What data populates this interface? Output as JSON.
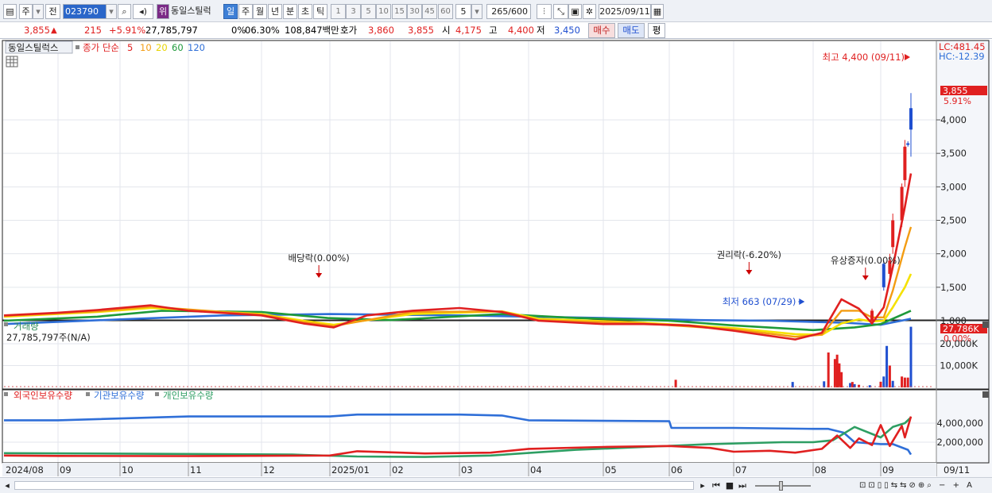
{
  "toolbar": {
    "type_label": "주",
    "prev_label": "전",
    "stock_code": "023790",
    "badge_label": "위",
    "stock_name": "동일스틸럭",
    "periods": [
      "일",
      "주",
      "월",
      "년",
      "분",
      "초",
      "틱"
    ],
    "active_period": "일",
    "intervals": [
      "1",
      "3",
      "5",
      "10",
      "15",
      "30",
      "45",
      "60"
    ],
    "interval_value": "5",
    "count_value": "265",
    "count_total": "/600",
    "date_value": "2025/09/11"
  },
  "quote": {
    "price": "3,855",
    "arrow": "▲",
    "change": "215",
    "change_pct": "+5.91%",
    "volume": "27,785,797",
    "turnover_pct": "0%",
    "rate": "06.30%",
    "amount": "108,847백만",
    "hoga_label": "호가",
    "ask": "3,860",
    "bid": "3,855",
    "open_label": "시",
    "open": "4,175",
    "high_label": "고",
    "high": "4,400",
    "low_label": "저",
    "low": "3,450",
    "buy_label": "매수",
    "sell_label": "매도",
    "avg_label": "평"
  },
  "colors": {
    "up": "#e02020",
    "down": "#1f4fd0",
    "ma5": "#e02020",
    "ma10": "#f39c12",
    "ma20": "#f5e100",
    "ma60": "#1e9a3a",
    "ma120": "#2f6fd8",
    "foreign": "#e02020",
    "institution": "#2f6fd8",
    "individual": "#2e9e63",
    "accent": "#3d7fd6"
  },
  "chart_data": [
    {
      "type": "line",
      "panel": "price",
      "title": "동일스틸럭스",
      "indicator_label": "종가 단순",
      "ma_periods": [
        "5",
        "10",
        "20",
        "60",
        "120"
      ],
      "lc_label": "LC:481.45",
      "hc_label": "HC:-12.39",
      "current_price_tag": "3,855",
      "current_pct_tag": "5.91%",
      "y_ticks": [
        1000,
        1500,
        2000,
        2500,
        3000,
        3500,
        4000
      ],
      "y_tick_labels": [
        "1,000",
        "1,500",
        "2,000",
        "2,500",
        "3,000",
        "3,500",
        "4,000"
      ],
      "ylim": [
        620,
        4600
      ],
      "x_tick_labels": [
        "2024/08",
        "09",
        "10",
        "11",
        "12",
        "2025/01",
        "02",
        "03",
        "04",
        "05",
        "06",
        "07",
        "08",
        "09",
        "09/11"
      ],
      "annotations": [
        {
          "text": "최고 4,400 (09/11)",
          "date": "2025-09-11",
          "value": 4400
        },
        {
          "text": "최저 663 (07/29)",
          "date": "2025-07-29",
          "value": 663
        },
        {
          "text": "배당락(0.00%)",
          "date": "2024-12-27"
        },
        {
          "text": "권리락(-6.20%)",
          "date": "2025-07-07"
        },
        {
          "text": "유상증자(0.00%)",
          "date": "2025-08-25"
        }
      ],
      "series": [
        {
          "name": "5",
          "x": [
            "2024-08-01",
            "2024-09-01",
            "2024-09-20",
            "2024-10-15",
            "2024-11-01",
            "2024-12-01",
            "2024-12-20",
            "2025-01-03",
            "2025-01-20",
            "2025-02-10",
            "2025-03-01",
            "2025-03-20",
            "2025-04-05",
            "2025-05-01",
            "2025-05-20",
            "2025-06-10",
            "2025-07-01",
            "2025-07-25",
            "2025-08-05",
            "2025-08-14",
            "2025-08-22",
            "2025-08-28",
            "2025-09-02",
            "2025-09-05",
            "2025-09-09",
            "2025-09-11"
          ],
          "values": [
            1080,
            1120,
            1160,
            1230,
            1150,
            1080,
            960,
            900,
            1080,
            1150,
            1190,
            1130,
            1000,
            950,
            950,
            930,
            850,
            720,
            820,
            1320,
            1180,
            960,
            1200,
            1800,
            2700,
            3200
          ]
        },
        {
          "name": "10",
          "x": [
            "2024-08-01",
            "2024-09-20",
            "2024-10-15",
            "2024-12-01",
            "2024-12-20",
            "2025-01-03",
            "2025-02-10",
            "2025-03-20",
            "2025-04-05",
            "2025-05-20",
            "2025-07-01",
            "2025-07-25",
            "2025-08-05",
            "2025-08-14",
            "2025-08-22",
            "2025-08-28",
            "2025-09-02",
            "2025-09-05",
            "2025-09-09",
            "2025-09-11"
          ],
          "values": [
            1070,
            1140,
            1210,
            1090,
            980,
            920,
            1130,
            1140,
            1010,
            960,
            870,
            760,
            790,
            1150,
            1150,
            1050,
            1050,
            1450,
            2100,
            2400
          ]
        },
        {
          "name": "20",
          "x": [
            "2024-08-01",
            "2024-09-20",
            "2024-10-15",
            "2024-12-01",
            "2024-12-20",
            "2025-01-03",
            "2025-02-10",
            "2025-03-20",
            "2025-04-05",
            "2025-05-20",
            "2025-07-01",
            "2025-07-25",
            "2025-08-05",
            "2025-08-14",
            "2025-08-22",
            "2025-08-28",
            "2025-09-02",
            "2025-09-05",
            "2025-09-09",
            "2025-09-11"
          ],
          "values": [
            1060,
            1130,
            1190,
            1100,
            1000,
            940,
            1100,
            1140,
            1030,
            970,
            890,
            800,
            790,
            960,
            1020,
            990,
            1000,
            1200,
            1500,
            1700
          ]
        },
        {
          "name": "60",
          "x": [
            "2024-08-01",
            "2024-09-20",
            "2024-10-20",
            "2024-12-01",
            "2024-12-31",
            "2025-02-01",
            "2025-03-20",
            "2025-04-20",
            "2025-06-01",
            "2025-07-01",
            "2025-08-01",
            "2025-08-20",
            "2025-09-01",
            "2025-09-11"
          ],
          "values": [
            1000,
            1060,
            1150,
            1130,
            1040,
            1010,
            1100,
            1040,
            1000,
            930,
            860,
            900,
            950,
            1150
          ]
        },
        {
          "name": "120",
          "x": [
            "2024-08-01",
            "2024-10-01",
            "2024-11-15",
            "2025-01-01",
            "2025-03-01",
            "2025-05-01",
            "2025-06-15",
            "2025-07-15",
            "2025-08-15",
            "2025-09-01",
            "2025-09-11"
          ],
          "values": [
            950,
            1020,
            1080,
            1100,
            1080,
            1040,
            1010,
            1000,
            970,
            940,
            1030
          ]
        }
      ]
    },
    {
      "type": "bar",
      "panel": "volume",
      "title": "거래량",
      "volume_readout": "27,785,797주(N/A)",
      "current_tag": "27,786K",
      "current_pct_tag": "0.00%",
      "y_ticks": [
        10000,
        20000
      ],
      "y_tick_labels": [
        "10,000K",
        "20,000K"
      ],
      "ylim": [
        0,
        28000
      ],
      "x": [
        "2025-06-04",
        "2025-07-24",
        "2025-08-06",
        "2025-08-08",
        "2025-08-11",
        "2025-08-12",
        "2025-08-13",
        "2025-08-14",
        "2025-08-18",
        "2025-08-19",
        "2025-08-20",
        "2025-08-22",
        "2025-08-27",
        "2025-09-01",
        "2025-09-02",
        "2025-09-03",
        "2025-09-04",
        "2025-09-05",
        "2025-09-08",
        "2025-09-09",
        "2025-09-10",
        "2025-09-11"
      ],
      "values": [
        3500,
        2500,
        2800,
        16000,
        13000,
        15000,
        11000,
        7000,
        2000,
        2500,
        1500,
        1200,
        1000,
        2600,
        5000,
        19000,
        10000,
        3000,
        5000,
        4500,
        4500,
        27786
      ],
      "colors": [
        "up",
        "down",
        "down",
        "up",
        "up",
        "up",
        "up",
        "up",
        "down",
        "up",
        "down",
        "up",
        "down",
        "up",
        "down",
        "down",
        "up",
        "down",
        "up",
        "up",
        "up",
        "down"
      ]
    },
    {
      "type": "line",
      "panel": "holdings",
      "series_labels": [
        "외국인보유수량",
        "기관보유수량",
        "개인보유수량"
      ],
      "y_ticks": [
        2000000,
        4000000
      ],
      "y_tick_labels": [
        "2,000,000",
        "4,000,000"
      ],
      "ylim": [
        0,
        5200000
      ],
      "series": [
        {
          "name": "외국인보유수량",
          "x": [
            "2024-08-01",
            "2024-09-01",
            "2024-11-01",
            "2025-01-01",
            "2025-01-15",
            "2025-02-15",
            "2025-03-15",
            "2025-04-01",
            "2025-05-01",
            "2025-06-01",
            "2025-06-20",
            "2025-07-01",
            "2025-07-15",
            "2025-07-25",
            "2025-08-05",
            "2025-08-12",
            "2025-08-18",
            "2025-08-22",
            "2025-08-28",
            "2025-09-01",
            "2025-09-04",
            "2025-09-08",
            "2025-09-09",
            "2025-09-11"
          ],
          "values": [
            600000,
            560000,
            540000,
            600000,
            1050000,
            820000,
            900000,
            1300000,
            1500000,
            1600000,
            1400000,
            1000000,
            1100000,
            900000,
            1300000,
            2700000,
            1400000,
            2400000,
            1700000,
            3800000,
            1600000,
            3700000,
            2500000,
            4700000
          ]
        },
        {
          "name": "기관보유수량",
          "x": [
            "2024-08-01",
            "2024-09-01",
            "2024-11-01",
            "2025-01-01",
            "2025-01-15",
            "2025-03-01",
            "2025-03-20",
            "2025-04-01",
            "2025-06-01",
            "2025-06-02",
            "2025-07-01",
            "2025-08-01",
            "2025-08-08",
            "2025-08-15",
            "2025-08-20",
            "2025-09-01",
            "2025-09-05",
            "2025-09-10",
            "2025-09-11"
          ],
          "values": [
            4300000,
            4300000,
            4700000,
            4700000,
            4900000,
            4900000,
            4800000,
            4300000,
            4200000,
            3500000,
            3500000,
            3400000,
            3400000,
            3000000,
            2000000,
            1800000,
            1800000,
            1200000,
            700000
          ]
        },
        {
          "name": "개인보유수량",
          "x": [
            "2024-08-01",
            "2024-10-01",
            "2024-12-15",
            "2025-01-15",
            "2025-02-15",
            "2025-03-15",
            "2025-04-20",
            "2025-05-20",
            "2025-06-20",
            "2025-07-20",
            "2025-08-01",
            "2025-08-10",
            "2025-08-20",
            "2025-09-01",
            "2025-09-05",
            "2025-09-09",
            "2025-09-11"
          ],
          "values": [
            850000,
            800000,
            700000,
            500000,
            450000,
            600000,
            1200000,
            1500000,
            1800000,
            2000000,
            2000000,
            2200000,
            3600000,
            2500000,
            3600000,
            4000000,
            4600000
          ]
        }
      ]
    }
  ]
}
